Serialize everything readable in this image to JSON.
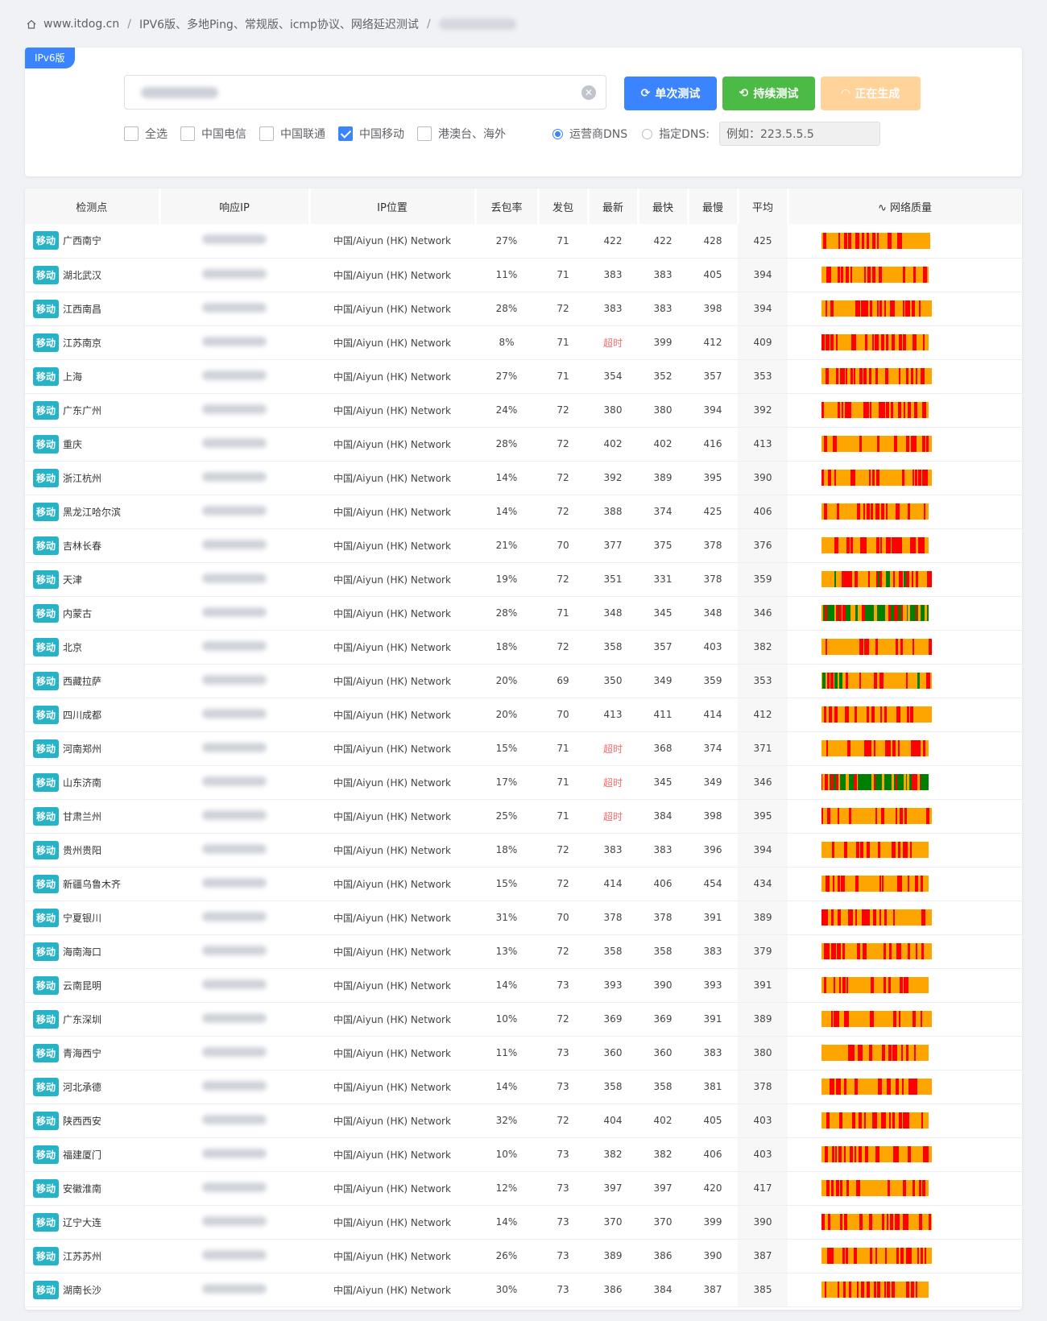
{
  "breadcrumb": {
    "home": "www.itdog.cn",
    "page": "IPV6版、多地Ping、常规版、icmp协议、网络延迟测试"
  },
  "panel": {
    "tag": "IPv6版",
    "buttons": {
      "single": "单次测试",
      "continuous": "持续测试",
      "generating": "正在生成"
    },
    "checkboxes": [
      {
        "label": "全选",
        "checked": false
      },
      {
        "label": "中国电信",
        "checked": false
      },
      {
        "label": "中国联通",
        "checked": false
      },
      {
        "label": "中国移动",
        "checked": true
      },
      {
        "label": "港澳台、海外",
        "checked": false
      }
    ],
    "radios": [
      {
        "label": "运营商DNS",
        "checked": true
      },
      {
        "label": "指定DNS:",
        "checked": false
      }
    ],
    "dns_placeholder": "例如：223.5.5.5"
  },
  "colors": {
    "orange": "#ffa500",
    "red": "#ff0000",
    "green": "#008000",
    "blue": "#3a84ff",
    "tag": "#26b3c6"
  },
  "table": {
    "headers": [
      "检测点",
      "响应IP",
      "IP位置",
      "丢包率",
      "发包",
      "最新",
      "最快",
      "最慢",
      "平均",
      "网络质量"
    ],
    "rows": [
      {
        "carrier": "移动",
        "loc": "广西南宁",
        "ip_loc": "中国/Aiyun (HK) Network",
        "loss": "27%",
        "sent": "71",
        "latest": "422",
        "fastest": "422",
        "slowest": "428",
        "avg": "425",
        "base": "orange",
        "seed": 3
      },
      {
        "carrier": "移动",
        "loc": "湖北武汉",
        "ip_loc": "中国/Aiyun (HK) Network",
        "loss": "11%",
        "sent": "71",
        "latest": "383",
        "fastest": "383",
        "slowest": "405",
        "avg": "394",
        "base": "orange",
        "seed": 7
      },
      {
        "carrier": "移动",
        "loc": "江西南昌",
        "ip_loc": "中国/Aiyun (HK) Network",
        "loss": "28%",
        "sent": "72",
        "latest": "383",
        "fastest": "383",
        "slowest": "398",
        "avg": "394",
        "base": "orange",
        "seed": 11
      },
      {
        "carrier": "移动",
        "loc": "江苏南京",
        "ip_loc": "中国/Aiyun (HK) Network",
        "loss": "8%",
        "sent": "71",
        "latest": "超时",
        "fastest": "399",
        "slowest": "412",
        "avg": "409",
        "base": "orange",
        "seed": 13
      },
      {
        "carrier": "移动",
        "loc": "上海",
        "ip_loc": "中国/Aiyun (HK) Network",
        "loss": "27%",
        "sent": "71",
        "latest": "354",
        "fastest": "352",
        "slowest": "357",
        "avg": "353",
        "base": "orange",
        "seed": 17
      },
      {
        "carrier": "移动",
        "loc": "广东广州",
        "ip_loc": "中国/Aiyun (HK) Network",
        "loss": "24%",
        "sent": "72",
        "latest": "380",
        "fastest": "380",
        "slowest": "394",
        "avg": "392",
        "base": "orange",
        "seed": 19
      },
      {
        "carrier": "移动",
        "loc": "重庆",
        "ip_loc": "中国/Aiyun (HK) Network",
        "loss": "28%",
        "sent": "72",
        "latest": "402",
        "fastest": "402",
        "slowest": "416",
        "avg": "413",
        "base": "orange",
        "seed": 23
      },
      {
        "carrier": "移动",
        "loc": "浙江杭州",
        "ip_loc": "中国/Aiyun (HK) Network",
        "loss": "14%",
        "sent": "72",
        "latest": "392",
        "fastest": "389",
        "slowest": "395",
        "avg": "390",
        "base": "orange",
        "seed": 29
      },
      {
        "carrier": "移动",
        "loc": "黑龙江哈尔滨",
        "ip_loc": "中国/Aiyun (HK) Network",
        "loss": "14%",
        "sent": "72",
        "latest": "388",
        "fastest": "374",
        "slowest": "425",
        "avg": "406",
        "base": "orange",
        "seed": 31
      },
      {
        "carrier": "移动",
        "loc": "吉林长春",
        "ip_loc": "中国/Aiyun (HK) Network",
        "loss": "21%",
        "sent": "70",
        "latest": "377",
        "fastest": "375",
        "slowest": "378",
        "avg": "376",
        "base": "orange",
        "seed": 37
      },
      {
        "carrier": "移动",
        "loc": "天津",
        "ip_loc": "中国/Aiyun (HK) Network",
        "loss": "19%",
        "sent": "72",
        "latest": "351",
        "fastest": "331",
        "slowest": "378",
        "avg": "359",
        "base": "orange",
        "seed": 41,
        "greens": true
      },
      {
        "carrier": "移动",
        "loc": "内蒙古",
        "ip_loc": "中国/Aiyun (HK) Network",
        "loss": "28%",
        "sent": "71",
        "latest": "348",
        "fastest": "345",
        "slowest": "348",
        "avg": "346",
        "base": "green",
        "seed": 43
      },
      {
        "carrier": "移动",
        "loc": "北京",
        "ip_loc": "中国/Aiyun (HK) Network",
        "loss": "18%",
        "sent": "72",
        "latest": "358",
        "fastest": "357",
        "slowest": "403",
        "avg": "382",
        "base": "orange",
        "seed": 47
      },
      {
        "carrier": "移动",
        "loc": "西藏拉萨",
        "ip_loc": "中国/Aiyun (HK) Network",
        "loss": "20%",
        "sent": "69",
        "latest": "350",
        "fastest": "349",
        "slowest": "359",
        "avg": "353",
        "base": "orange",
        "seed": 53,
        "greens": true
      },
      {
        "carrier": "移动",
        "loc": "四川成都",
        "ip_loc": "中国/Aiyun (HK) Network",
        "loss": "20%",
        "sent": "70",
        "latest": "413",
        "fastest": "411",
        "slowest": "414",
        "avg": "412",
        "base": "orange",
        "seed": 59
      },
      {
        "carrier": "移动",
        "loc": "河南郑州",
        "ip_loc": "中国/Aiyun (HK) Network",
        "loss": "15%",
        "sent": "71",
        "latest": "超时",
        "fastest": "368",
        "slowest": "374",
        "avg": "371",
        "base": "orange",
        "seed": 61
      },
      {
        "carrier": "移动",
        "loc": "山东济南",
        "ip_loc": "中国/Aiyun (HK) Network",
        "loss": "17%",
        "sent": "71",
        "latest": "超时",
        "fastest": "345",
        "slowest": "349",
        "avg": "346",
        "base": "green",
        "seed": 67
      },
      {
        "carrier": "移动",
        "loc": "甘肃兰州",
        "ip_loc": "中国/Aiyun (HK) Network",
        "loss": "25%",
        "sent": "71",
        "latest": "超时",
        "fastest": "384",
        "slowest": "398",
        "avg": "395",
        "base": "orange",
        "seed": 71
      },
      {
        "carrier": "移动",
        "loc": "贵州贵阳",
        "ip_loc": "中国/Aiyun (HK) Network",
        "loss": "18%",
        "sent": "72",
        "latest": "383",
        "fastest": "383",
        "slowest": "396",
        "avg": "394",
        "base": "orange",
        "seed": 73
      },
      {
        "carrier": "移动",
        "loc": "新疆乌鲁木齐",
        "ip_loc": "中国/Aiyun (HK) Network",
        "loss": "15%",
        "sent": "72",
        "latest": "414",
        "fastest": "406",
        "slowest": "454",
        "avg": "434",
        "base": "orange",
        "seed": 79
      },
      {
        "carrier": "移动",
        "loc": "宁夏银川",
        "ip_loc": "中国/Aiyun (HK) Network",
        "loss": "31%",
        "sent": "70",
        "latest": "378",
        "fastest": "378",
        "slowest": "391",
        "avg": "389",
        "base": "orange",
        "seed": 83
      },
      {
        "carrier": "移动",
        "loc": "海南海口",
        "ip_loc": "中国/Aiyun (HK) Network",
        "loss": "13%",
        "sent": "72",
        "latest": "358",
        "fastest": "358",
        "slowest": "383",
        "avg": "379",
        "base": "orange",
        "seed": 89
      },
      {
        "carrier": "移动",
        "loc": "云南昆明",
        "ip_loc": "中国/Aiyun (HK) Network",
        "loss": "14%",
        "sent": "73",
        "latest": "393",
        "fastest": "390",
        "slowest": "393",
        "avg": "391",
        "base": "orange",
        "seed": 97
      },
      {
        "carrier": "移动",
        "loc": "广东深圳",
        "ip_loc": "中国/Aiyun (HK) Network",
        "loss": "10%",
        "sent": "72",
        "latest": "369",
        "fastest": "369",
        "slowest": "391",
        "avg": "389",
        "base": "orange",
        "seed": 101
      },
      {
        "carrier": "移动",
        "loc": "青海西宁",
        "ip_loc": "中国/Aiyun (HK) Network",
        "loss": "11%",
        "sent": "73",
        "latest": "360",
        "fastest": "360",
        "slowest": "383",
        "avg": "380",
        "base": "orange",
        "seed": 103
      },
      {
        "carrier": "移动",
        "loc": "河北承德",
        "ip_loc": "中国/Aiyun (HK) Network",
        "loss": "14%",
        "sent": "73",
        "latest": "358",
        "fastest": "358",
        "slowest": "381",
        "avg": "378",
        "base": "orange",
        "seed": 107
      },
      {
        "carrier": "移动",
        "loc": "陕西西安",
        "ip_loc": "中国/Aiyun (HK) Network",
        "loss": "32%",
        "sent": "72",
        "latest": "404",
        "fastest": "402",
        "slowest": "405",
        "avg": "403",
        "base": "orange",
        "seed": 109
      },
      {
        "carrier": "移动",
        "loc": "福建厦门",
        "ip_loc": "中国/Aiyun (HK) Network",
        "loss": "10%",
        "sent": "73",
        "latest": "382",
        "fastest": "382",
        "slowest": "406",
        "avg": "403",
        "base": "orange",
        "seed": 113
      },
      {
        "carrier": "移动",
        "loc": "安徽淮南",
        "ip_loc": "中国/Aiyun (HK) Network",
        "loss": "12%",
        "sent": "73",
        "latest": "397",
        "fastest": "397",
        "slowest": "420",
        "avg": "417",
        "base": "orange",
        "seed": 127
      },
      {
        "carrier": "移动",
        "loc": "辽宁大连",
        "ip_loc": "中国/Aiyun (HK) Network",
        "loss": "14%",
        "sent": "73",
        "latest": "370",
        "fastest": "370",
        "slowest": "399",
        "avg": "390",
        "base": "orange",
        "seed": 131
      },
      {
        "carrier": "移动",
        "loc": "江苏苏州",
        "ip_loc": "中国/Aiyun (HK) Network",
        "loss": "26%",
        "sent": "73",
        "latest": "389",
        "fastest": "386",
        "slowest": "390",
        "avg": "387",
        "base": "orange",
        "seed": 137
      },
      {
        "carrier": "移动",
        "loc": "湖南长沙",
        "ip_loc": "中国/Aiyun (HK) Network",
        "loss": "30%",
        "sent": "73",
        "latest": "386",
        "fastest": "384",
        "slowest": "387",
        "avg": "385",
        "base": "orange",
        "seed": 139
      }
    ]
  }
}
